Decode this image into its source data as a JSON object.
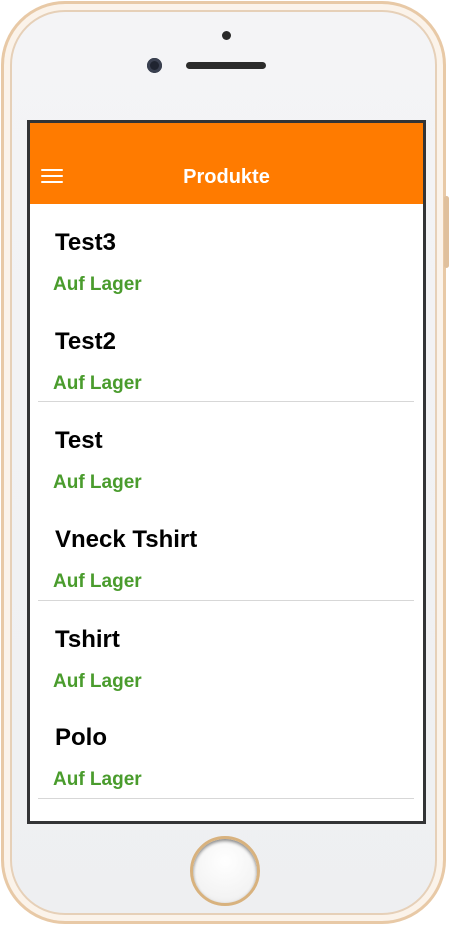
{
  "app_bar": {
    "title": "Produkte",
    "menu_icon": "hamburger-menu-icon",
    "background_color": "#ff7b00"
  },
  "products": [
    {
      "name": "Test3",
      "status": "Auf Lager"
    },
    {
      "name": "Test2",
      "status": "Auf Lager"
    },
    {
      "name": "Test",
      "status": "Auf Lager"
    },
    {
      "name": "Vneck Tshirt",
      "status": "Auf Lager"
    },
    {
      "name": "Tshirt",
      "status": "Auf Lager"
    },
    {
      "name": "Polo",
      "status": "Auf Lager"
    }
  ],
  "colors": {
    "status_in_stock": "#4a9c2d",
    "phone_frame": "#e8c9a6"
  }
}
